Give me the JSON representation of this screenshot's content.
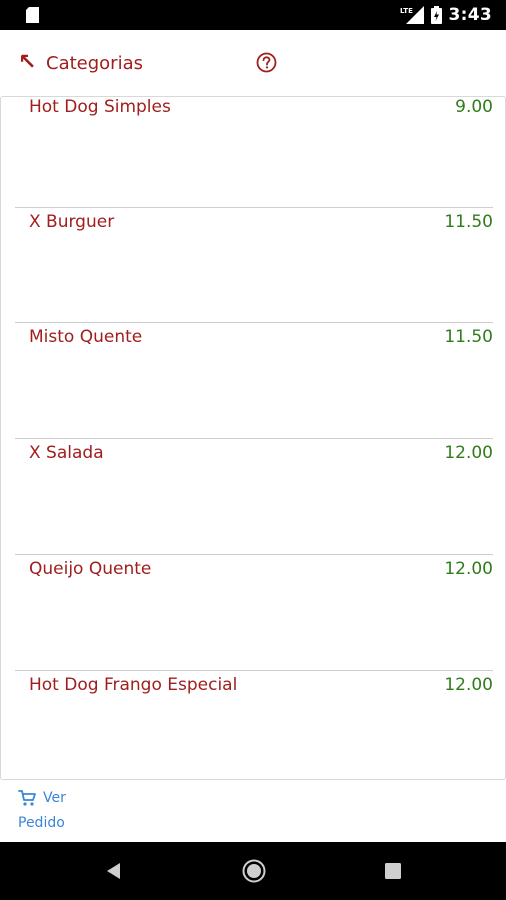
{
  "status_bar": {
    "time": "3:43",
    "icons": [
      "sd-card-icon",
      "lte-signal-icon",
      "battery-icon"
    ]
  },
  "header": {
    "back_icon": "↖",
    "title": "Categorias",
    "help_icon": "help-circle-icon"
  },
  "products": [
    {
      "name": "Hot Dog Simples",
      "price": "9.00"
    },
    {
      "name": "X Burguer",
      "price": "11.50"
    },
    {
      "name": "Misto Quente",
      "price": "11.50"
    },
    {
      "name": "X Salada",
      "price": "12.00"
    },
    {
      "name": "Queijo Quente",
      "price": "12.00"
    },
    {
      "name": "Hot Dog Frango Especial",
      "price": "12.00"
    }
  ],
  "bottom_action": {
    "line1": "Ver",
    "line2": "Pedido",
    "icon": "cart-icon"
  },
  "nav_bar": {
    "buttons": [
      "nav-back-icon",
      "nav-home-icon",
      "nav-recents-icon"
    ]
  },
  "colors": {
    "accent_red": "#a01e1e",
    "price_green": "#2f7d1a",
    "link_blue": "#3a86d8"
  }
}
